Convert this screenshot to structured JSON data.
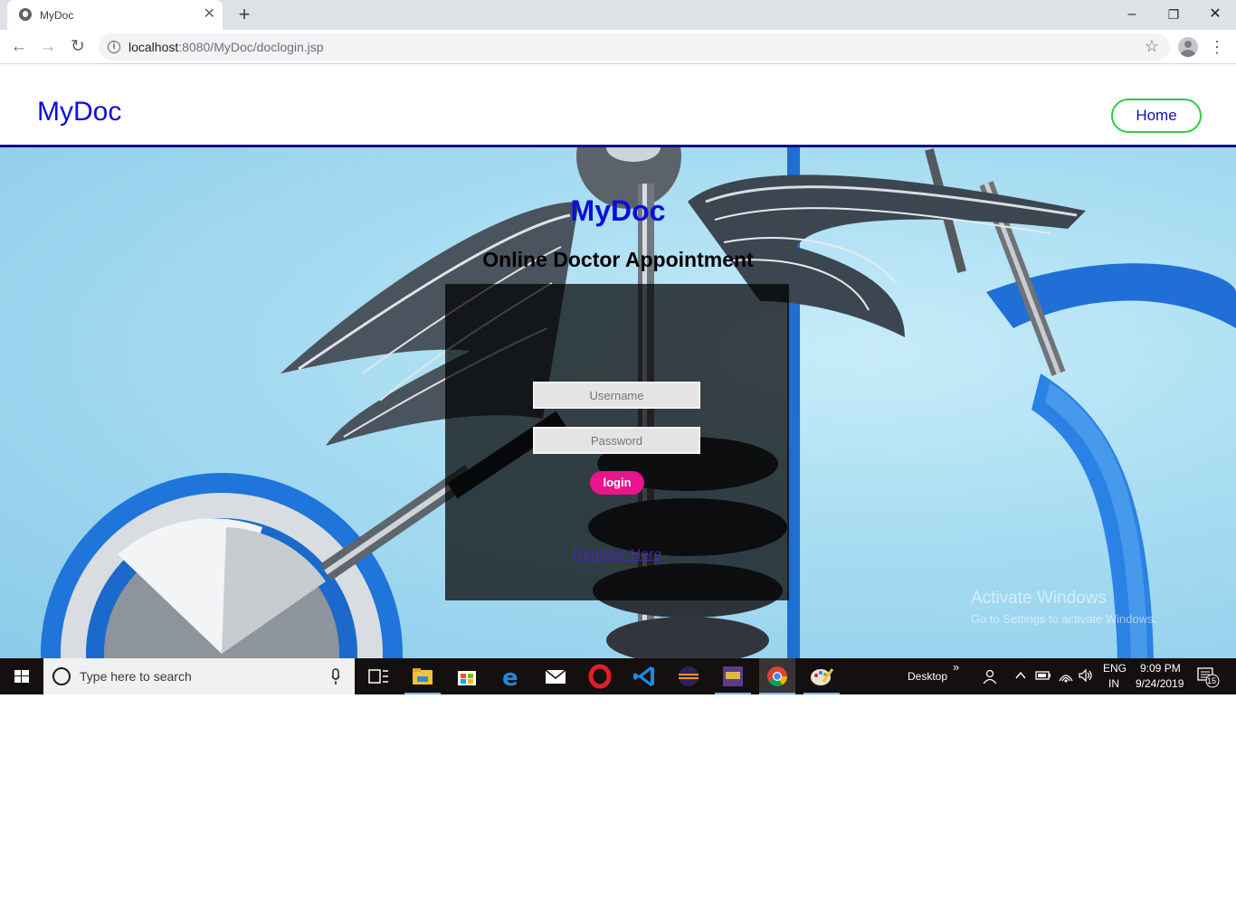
{
  "browser": {
    "tab_title": "MyDoc",
    "tab_close": "✕",
    "new_tab": "+",
    "url_host": "localhost",
    "url_rest": ":8080/MyDoc/doclogin.jsp",
    "window_controls": {
      "minimize": "–",
      "restore": "❐",
      "close": "✕"
    },
    "nav": {
      "back": "←",
      "forward": "→",
      "reload": "↻"
    },
    "star": "☆",
    "menu": "⋮"
  },
  "site": {
    "brand": "MyDoc",
    "home_label": "Home",
    "hero_title": "MyDoc",
    "hero_subtitle": "Online Doctor Appointment",
    "username_placeholder": "Username",
    "password_placeholder": "Password",
    "login_label": "login",
    "register_label": "Register Here",
    "activate_title": "Activate Windows",
    "activate_sub": "Go to Settings to activate Windows."
  },
  "taskbar": {
    "search_placeholder": "Type here to search",
    "desktop_label": "Desktop",
    "chevron": "»",
    "lang_top": "ENG",
    "lang_bottom": "IN",
    "time": "9:09 PM",
    "date": "9/24/2019",
    "notification_count": "15",
    "pinned_apps": [
      "task-view",
      "file-explorer",
      "microsoft-store",
      "edge",
      "mail",
      "opera",
      "vs-code",
      "eclipse",
      "game-app",
      "chrome",
      "paint"
    ]
  },
  "colors": {
    "brand_blue": "#0d0ddb",
    "home_border": "#2ecc40",
    "login_pink": "#e8158c",
    "navbar_rule": "#0a0a8c"
  }
}
